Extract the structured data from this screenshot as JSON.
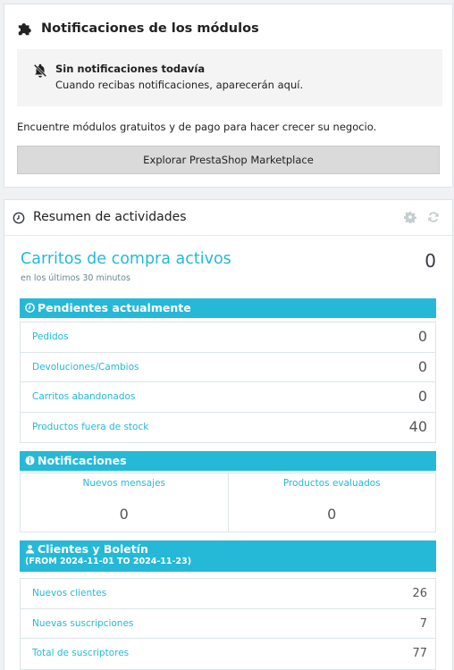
{
  "module_notifications": {
    "title": "Notificaciones de los módulos",
    "empty_title": "Sin notificaciones todavía",
    "empty_subtitle": "Cuando recibas notificaciones, aparecerán aquí.",
    "description": "Encuentre módulos gratuitos y de pago para hacer crecer su negocio.",
    "button_label": "Explorar PrestaShop Marketplace"
  },
  "activity": {
    "title": "Resumen de actividades",
    "active_carts": {
      "title": "Carritos de compra activos",
      "subtitle": "en los últimos 30 minutos",
      "value": "0"
    },
    "pending": {
      "title": "Pendientes actualmente",
      "rows": [
        {
          "label": "Pedidos",
          "value": "0"
        },
        {
          "label": "Devoluciones/Cambios",
          "value": "0"
        },
        {
          "label": "Carritos abandonados",
          "value": "0"
        },
        {
          "label": "Productos fuera de stock",
          "value": "40"
        }
      ]
    },
    "notifications": {
      "title": "Notificaciones",
      "cells": [
        {
          "label": "Nuevos mensajes",
          "value": "0"
        },
        {
          "label": "Productos evaluados",
          "value": "0"
        }
      ]
    },
    "customers": {
      "title": "Clientes y Boletín",
      "range": "(FROM 2024-11-01 TO 2024-11-23)",
      "rows": [
        {
          "label": "Nuevos clientes",
          "value": "26"
        },
        {
          "label": "Nuevas suscripciones",
          "value": "7"
        },
        {
          "label": "Total de suscriptores",
          "value": "77"
        }
      ]
    }
  },
  "icons": {
    "header": "puzzle-icon",
    "empty": "bell-slash-icon",
    "activity": "clock-icon",
    "settings": "gear-icon",
    "refresh": "refresh-icon",
    "pending": "clock-icon",
    "notifications": "info-icon",
    "customers": "user-icon"
  },
  "colors": {
    "accent": "#25b9d7",
    "text": "#363a41",
    "muted": "#6c868e",
    "border": "#dbe6e9",
    "button_bg": "#dadada"
  }
}
